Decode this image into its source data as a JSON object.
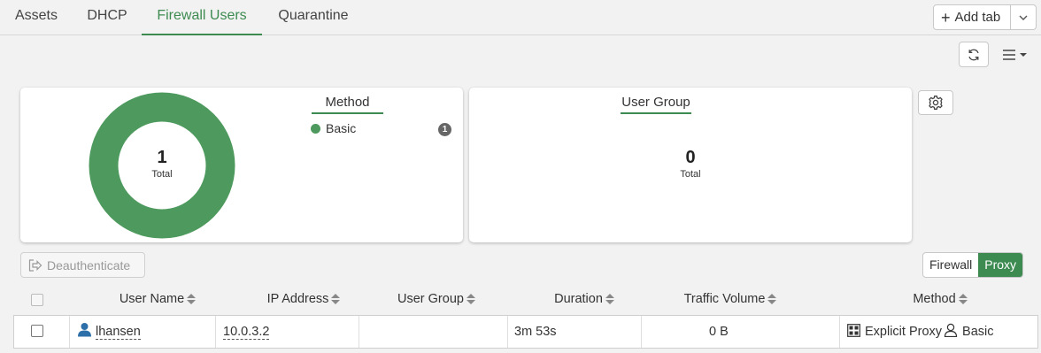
{
  "tabs": [
    {
      "label": "Assets"
    },
    {
      "label": "DHCP"
    },
    {
      "label": "Firewall Users",
      "active": true
    },
    {
      "label": "Quarantine"
    }
  ],
  "add_tab": {
    "label": "Add tab"
  },
  "accent_color": "#3d8b51",
  "method_widget": {
    "legend_title": "Method",
    "total_value": "1",
    "total_label": "Total",
    "items": [
      {
        "label": "Basic",
        "count": "1",
        "color": "#4e9a5e"
      }
    ]
  },
  "user_group_widget": {
    "legend_title": "User Group",
    "total_value": "0",
    "total_label": "Total"
  },
  "toolbar": {
    "deauth_label": "Deauthenticate",
    "toggle_firewall": "Firewall",
    "toggle_proxy": "Proxy",
    "selected": "Proxy"
  },
  "table": {
    "columns": [
      "User Name",
      "IP Address",
      "User Group",
      "Duration",
      "Traffic Volume",
      "Method"
    ],
    "rows": [
      {
        "user_name": "lhansen",
        "ip_address": "10.0.3.2",
        "user_group": "",
        "duration": "3m 53s",
        "traffic_volume": "0 B",
        "method_type": "Explicit Proxy",
        "method_auth": "Basic"
      }
    ]
  }
}
